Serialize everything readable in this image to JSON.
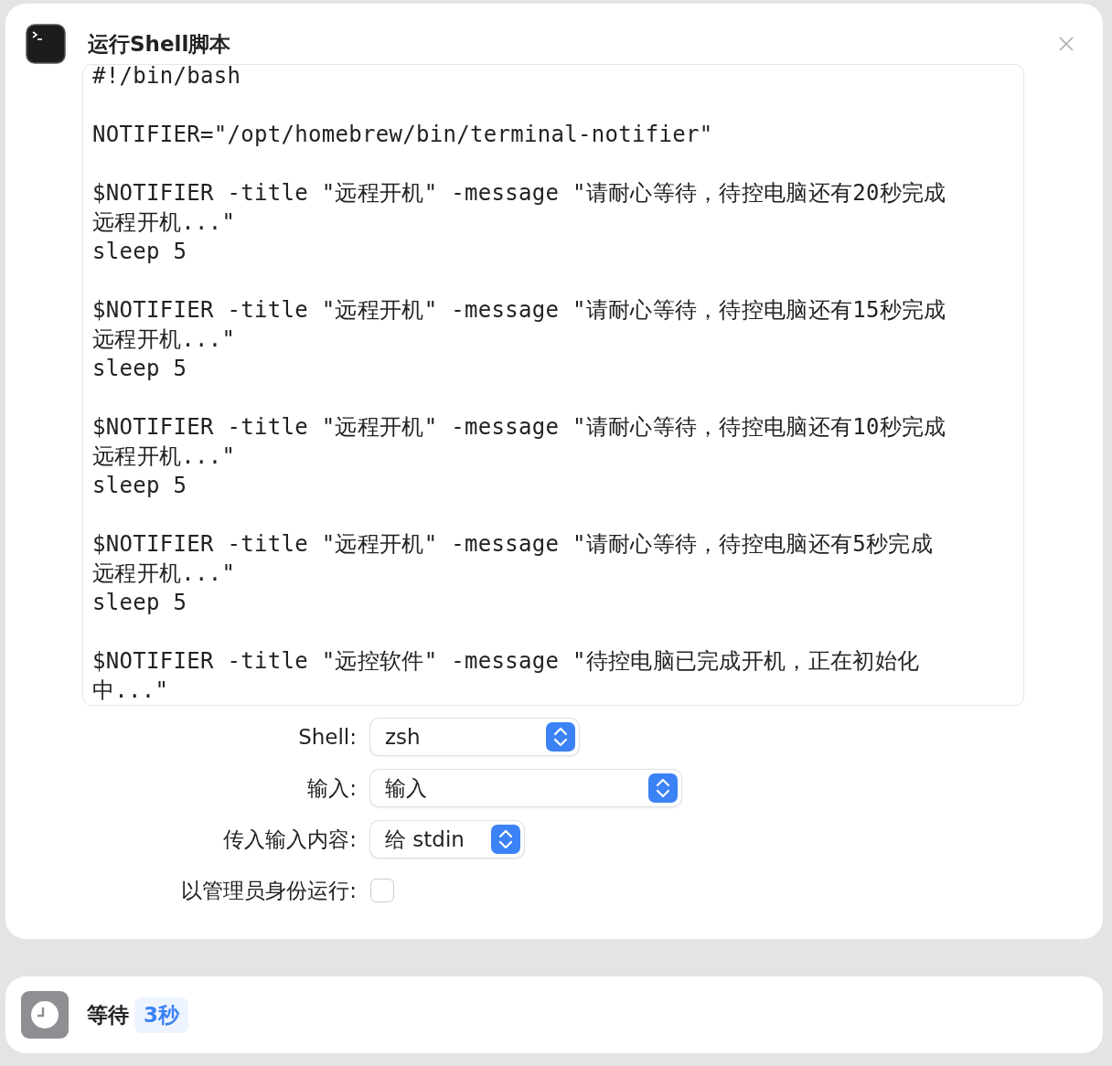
{
  "action": {
    "title": "运行Shell脚本",
    "script_blocks": [
      [
        "#!/bin/bash"
      ],
      [
        "NOTIFIER=\"/opt/homebrew/bin/terminal-notifier\""
      ],
      [
        "$NOTIFIER -title \"远程开机\" -message \"请耐心等待，待控电脑还有20秒完成",
        "远程开机...\"",
        "sleep 5"
      ],
      [
        "$NOTIFIER -title \"远程开机\" -message \"请耐心等待，待控电脑还有15秒完成",
        "远程开机...\"",
        "sleep 5"
      ],
      [
        "$NOTIFIER -title \"远程开机\" -message \"请耐心等待，待控电脑还有10秒完成",
        "远程开机...\"",
        "sleep 5"
      ],
      [
        "$NOTIFIER -title \"远程开机\" -message \"请耐心等待，待控电脑还有5秒完成",
        "远程开机...\"",
        "sleep 5"
      ],
      [
        "$NOTIFIER -title \"远控软件\" -message \"待控电脑已完成开机，正在初始化",
        "中...\""
      ]
    ],
    "options": [
      {
        "kind": "popup",
        "label": "Shell:",
        "value": "zsh"
      },
      {
        "kind": "popup",
        "label": "输入:",
        "value": "输入"
      },
      {
        "kind": "popup",
        "label": "传入输入内容:",
        "value": "给 stdin"
      },
      {
        "kind": "checkbox",
        "label": "以管理员身份运行:",
        "checked": false
      }
    ]
  },
  "wait_action": {
    "title": "等待",
    "value": "3秒"
  }
}
